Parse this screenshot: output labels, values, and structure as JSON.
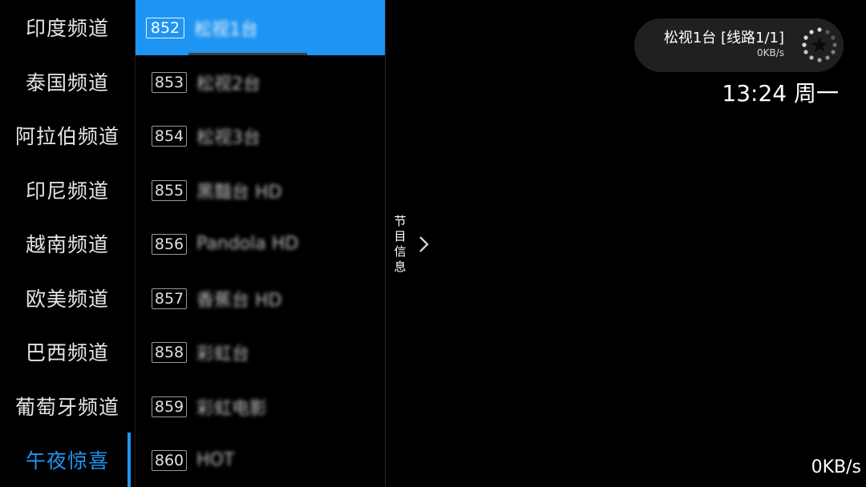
{
  "categories": [
    {
      "label": "印度频道"
    },
    {
      "label": "泰国频道"
    },
    {
      "label": "阿拉伯频道"
    },
    {
      "label": "印尼频道"
    },
    {
      "label": "越南频道"
    },
    {
      "label": "欧美频道"
    },
    {
      "label": "巴西频道"
    },
    {
      "label": "葡萄牙频道"
    },
    {
      "label": "午夜惊喜",
      "active": true
    }
  ],
  "channels": [
    {
      "num": "852",
      "name": "松视1台",
      "selected": true
    },
    {
      "num": "853",
      "name": "松视2台"
    },
    {
      "num": "854",
      "name": "松视3台"
    },
    {
      "num": "855",
      "name": "黑豔台 HD"
    },
    {
      "num": "856",
      "name": "Pandola HD"
    },
    {
      "num": "857",
      "name": "香蕉台 HD"
    },
    {
      "num": "858",
      "name": "彩虹台"
    },
    {
      "num": "859",
      "name": "彩虹电影"
    },
    {
      "num": "860",
      "name": "HOT"
    }
  ],
  "program_info": {
    "label": "节目信息"
  },
  "now_playing": {
    "title": "松视1台 [线路1/1]",
    "speed": "0KB/s"
  },
  "clock": "13:24 周一",
  "network_speed": "0KB/s",
  "colors": {
    "accent": "#2196f3",
    "selected_row": "#1e95f2",
    "pill_bg": "#202020"
  }
}
